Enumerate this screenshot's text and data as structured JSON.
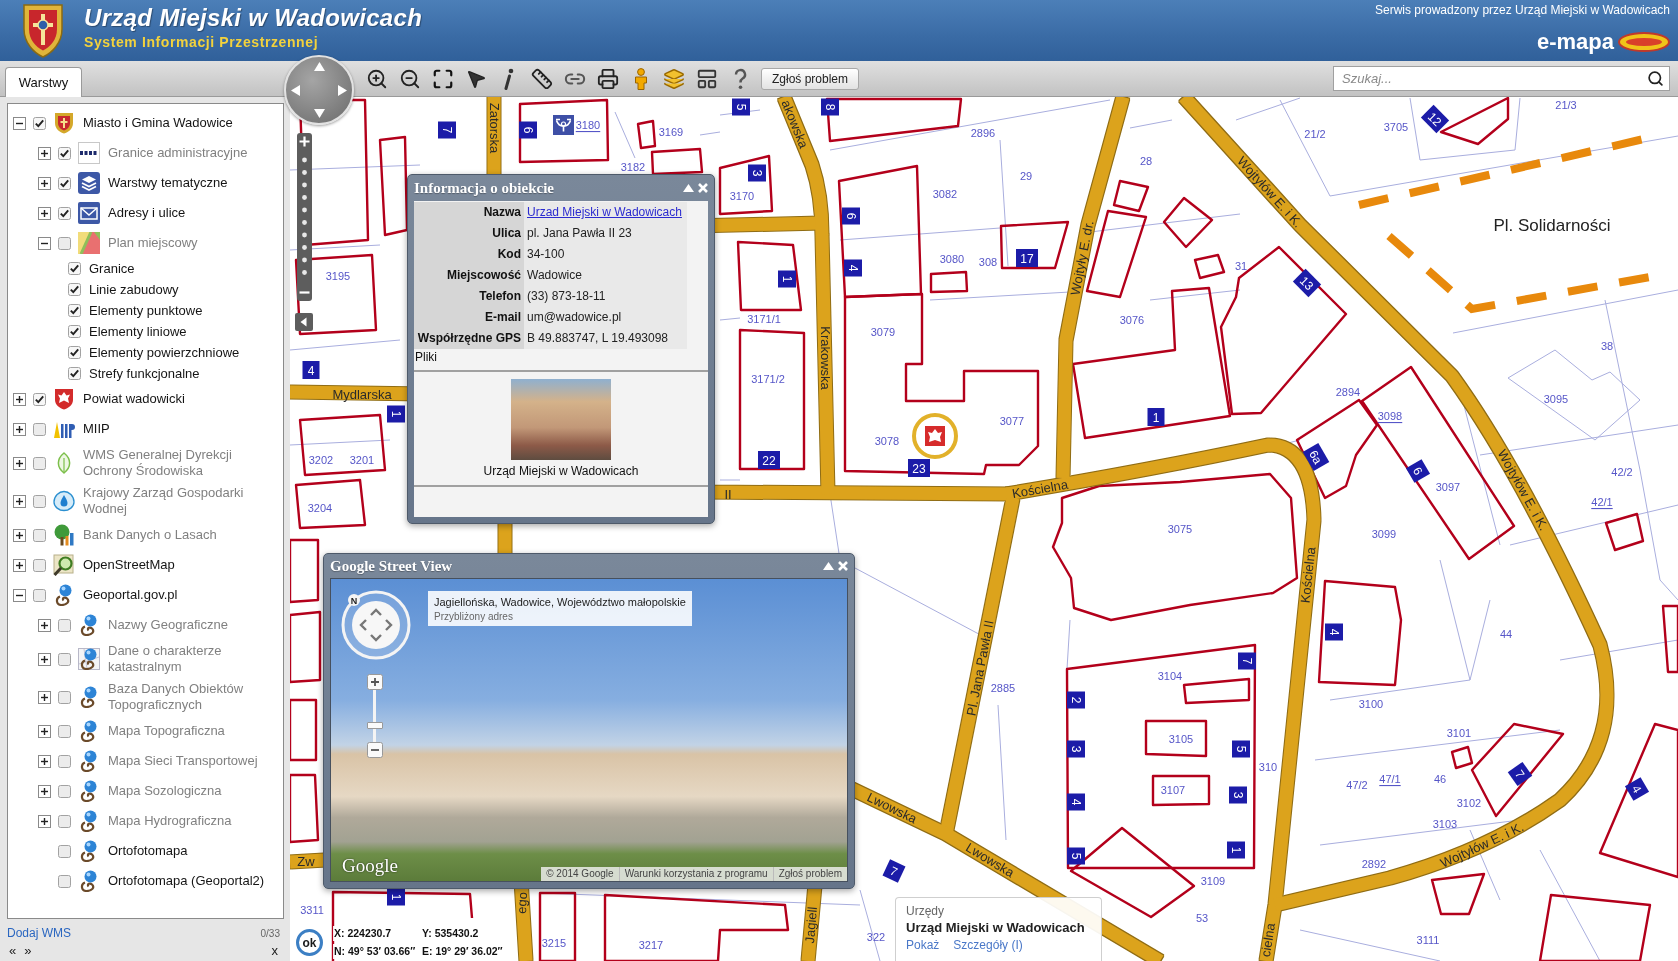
{
  "header": {
    "title": "Urząd Miejski w Wadowicach",
    "subtitle": "System Informacji Przestrzennej",
    "operator_note": "Serwis prowadzony przez Urząd Miejski w Wadowicach",
    "brand": "e-mapa"
  },
  "toolbar": {
    "tabs": [
      {
        "label": "Warstwy",
        "selected": true
      }
    ],
    "report_button": "Zgłoś problem",
    "search": {
      "placeholder": "Szukaj..."
    }
  },
  "layers": {
    "items": [
      {
        "label": "Miasto i Gmina Wadowice",
        "kind": "group",
        "expanded": true,
        "checked": true,
        "disabled": false,
        "children": [
          {
            "label": "Granice administracyjne",
            "kind": "group",
            "expanded": false,
            "checked": true,
            "disabled": true
          },
          {
            "label": "Warstwy tematyczne",
            "kind": "group",
            "expanded": false,
            "checked": true,
            "disabled": false
          },
          {
            "label": "Adresy i ulice",
            "kind": "group",
            "expanded": false,
            "checked": true,
            "disabled": false
          },
          {
            "label": "Plan miejscowy",
            "kind": "group",
            "expanded": true,
            "checked": false,
            "disabled": true,
            "children": [
              {
                "label": "Granice",
                "kind": "sublayer",
                "checked": true,
                "disabled": false
              },
              {
                "label": "Linie zabudowy",
                "kind": "sublayer",
                "checked": true,
                "disabled": false
              },
              {
                "label": "Elementy punktowe",
                "kind": "sublayer",
                "checked": true,
                "disabled": false
              },
              {
                "label": "Elementy liniowe",
                "kind": "sublayer",
                "checked": true,
                "disabled": false
              },
              {
                "label": "Elementy powierzchniowe",
                "kind": "sublayer",
                "checked": true,
                "disabled": false
              },
              {
                "label": "Strefy funkcjonalne",
                "kind": "sublayer",
                "checked": true,
                "disabled": false
              }
            ]
          }
        ]
      },
      {
        "label": "Powiat wadowicki",
        "kind": "group",
        "expanded": false,
        "checked": true,
        "disabled": false
      },
      {
        "label": "MIIP",
        "kind": "group",
        "expanded": false,
        "checked": false,
        "disabled": false
      },
      {
        "label": "WMS Generalnej Dyrekcji Ochrony Środowiska",
        "kind": "group",
        "expanded": false,
        "checked": false,
        "disabled": true
      },
      {
        "label": "Krajowy Zarząd Gospodarki Wodnej",
        "kind": "group",
        "expanded": false,
        "checked": false,
        "disabled": true
      },
      {
        "label": "Bank Danych o Lasach",
        "kind": "group",
        "expanded": false,
        "checked": false,
        "disabled": true
      },
      {
        "label": "OpenStreetMap",
        "kind": "group",
        "expanded": false,
        "checked": false,
        "disabled": false
      },
      {
        "label": "Geoportal.gov.pl",
        "kind": "group",
        "expanded": true,
        "checked": false,
        "disabled": false,
        "children": [
          {
            "label": "Nazwy Geograficzne",
            "kind": "group",
            "expanded": false,
            "checked": false,
            "disabled": true
          },
          {
            "label": "Dane o charakterze katastralnym",
            "kind": "group",
            "expanded": false,
            "checked": false,
            "disabled": true
          },
          {
            "label": "Baza Danych Obiektów Topograficznych",
            "kind": "group",
            "expanded": false,
            "checked": false,
            "disabled": true
          },
          {
            "label": "Mapa Topograficzna",
            "kind": "group",
            "expanded": false,
            "checked": false,
            "disabled": true
          },
          {
            "label": "Mapa Sieci Transportowej",
            "kind": "group",
            "expanded": false,
            "checked": false,
            "disabled": true
          },
          {
            "label": "Mapa Sozologiczna",
            "kind": "group",
            "expanded": false,
            "checked": false,
            "disabled": true
          },
          {
            "label": "Mapa Hydrograficzna",
            "kind": "group",
            "expanded": false,
            "checked": false,
            "disabled": true
          },
          {
            "label": "Ortofotomapa",
            "kind": "layer",
            "checked": false,
            "disabled": false
          },
          {
            "label": "Ortofotomapa (Geoportal2)",
            "kind": "layer",
            "checked": false,
            "disabled": false
          }
        ]
      }
    ],
    "add_wms_link": "Dodaj WMS",
    "counter": "0/33",
    "pager": [
      "«",
      "»"
    ],
    "close": "x"
  },
  "map": {
    "place_label": "Pl. Solidarności",
    "street_labels": [
      "Mydlarska",
      "akowska",
      "Krakowska",
      "Wojtyły E. dr.",
      "Wojtyłów E. i K.",
      "Kościelna",
      "Kościelna",
      "Wojtyłów E. i K.",
      "Pl. Jana Pawła II",
      "Lwowska",
      "Lwowska",
      "Wojtyłów E. i K.",
      "II",
      "Zw",
      "Zatorska",
      "ego",
      "Jagiell",
      "cielna"
    ],
    "parcel_numbers": [
      {
        "text": "2896",
        "underlined": false
      },
      {
        "text": "29",
        "underlined": false
      },
      {
        "text": "3082",
        "underlined": false
      },
      {
        "text": "3080",
        "underlined": false
      },
      {
        "text": "308",
        "underlined": false
      },
      {
        "text": "3079",
        "underlined": false
      },
      {
        "text": "3078",
        "underlined": false
      },
      {
        "text": "3077",
        "underlined": false
      },
      {
        "text": "3076",
        "underlined": false
      },
      {
        "text": "28",
        "underlined": false
      },
      {
        "text": "31",
        "underlined": false
      },
      {
        "text": "3705",
        "underlined": false
      },
      {
        "text": "21/2",
        "underlined": false
      },
      {
        "text": "21/3",
        "underlined": false
      },
      {
        "text": "38",
        "underlined": false
      },
      {
        "text": "3095",
        "underlined": false
      },
      {
        "text": "2894",
        "underlined": false
      },
      {
        "text": "3098",
        "underlined": true
      },
      {
        "text": "3097",
        "underlined": false
      },
      {
        "text": "3099",
        "underlined": false
      },
      {
        "text": "3075",
        "underlined": false
      },
      {
        "text": "42/2",
        "underlined": false
      },
      {
        "text": "42/1",
        "underlined": true
      },
      {
        "text": "44",
        "underlined": false
      },
      {
        "text": "3100",
        "underlined": false
      },
      {
        "text": "3101",
        "underlined": false
      },
      {
        "text": "47/2",
        "underlined": false
      },
      {
        "text": "47/1",
        "underlined": true
      },
      {
        "text": "46",
        "underlined": false
      },
      {
        "text": "3102",
        "underlined": false
      },
      {
        "text": "3103",
        "underlined": false
      },
      {
        "text": "2892",
        "underlined": false
      },
      {
        "text": "3111",
        "underlined": false
      },
      {
        "text": "3104",
        "underlined": false
      },
      {
        "text": "3105",
        "underlined": false
      },
      {
        "text": "3107",
        "underlined": false
      },
      {
        "text": "3109",
        "underlined": false
      },
      {
        "text": "53",
        "underlined": false
      },
      {
        "text": "2885",
        "underlined": false
      },
      {
        "text": "3171/1",
        "underlined": false
      },
      {
        "text": "3171/2",
        "underlined": false
      },
      {
        "text": "310",
        "underlined": false
      },
      {
        "text": "3170",
        "underlined": false
      },
      {
        "text": "3169",
        "underlined": false
      },
      {
        "text": "3195",
        "underlined": false
      },
      {
        "text": "3202",
        "underlined": false
      },
      {
        "text": "3201",
        "underlined": false
      },
      {
        "text": "3204",
        "underlined": false
      },
      {
        "text": "3311",
        "underlined": false
      },
      {
        "text": "3215",
        "underlined": false
      },
      {
        "text": "3217",
        "underlined": false
      },
      {
        "text": "322",
        "underlined": false
      },
      {
        "text": "3180",
        "underlined": true
      },
      {
        "text": "3182",
        "underlined": false
      }
    ],
    "house_numbers": [
      "5",
      "8",
      "3",
      "6",
      "4",
      "17",
      "1",
      "22",
      "23",
      "1",
      "13",
      "12",
      "6a",
      "6",
      "4",
      "7",
      "2",
      "3",
      "5",
      "4",
      "3",
      "5",
      "1",
      "7",
      "4",
      "7",
      "7",
      "6",
      "4",
      "1",
      "1"
    ]
  },
  "info_window": {
    "title": "Informacja o obiekcie",
    "fields": [
      {
        "label": "Nazwa",
        "value": "Urzad Miejski w Wadowicach",
        "kind": "link"
      },
      {
        "label": "Ulica",
        "value": "pl. Jana Pawła II 23",
        "kind": "text"
      },
      {
        "label": "Kod",
        "value": "34-100",
        "kind": "text"
      },
      {
        "label": "Miejscowość",
        "value": "Wadowice",
        "kind": "text"
      },
      {
        "label": "Telefon",
        "value": "(33) 873-18-11",
        "kind": "text"
      },
      {
        "label": "E-mail",
        "value": "um@wadowice.pl",
        "kind": "text"
      },
      {
        "label": "Współrzędne GPS",
        "value": "B 49.883747, L 19.493098",
        "kind": "text"
      }
    ],
    "files_label": "Pliki",
    "photo_caption": "Urząd Miejski w Wadowicach"
  },
  "street_view": {
    "title": "Google Street View",
    "compass_label": "N",
    "address": "Jagiellońska, Wadowice, Województwo małopolskie",
    "address_note": "Przybliżony adres",
    "zoom": {
      "level": 0.3
    },
    "logo": "Google",
    "footer_links": [
      "© 2014 Google",
      "Warunki korzystania z programu",
      "Zgłoś problem"
    ]
  },
  "coordinates": {
    "button": "ok",
    "x": "X: 224230.7",
    "y": "Y: 535430.2",
    "n": "N: 49° 53′ 03.66″",
    "e": "E: 19° 29′ 36.02″"
  },
  "feature_tooltip": {
    "category": "Urzędy",
    "name": "Urząd Miejski w Wadowicach",
    "links": [
      "Pokaż",
      "Szczegóły (I)"
    ]
  }
}
